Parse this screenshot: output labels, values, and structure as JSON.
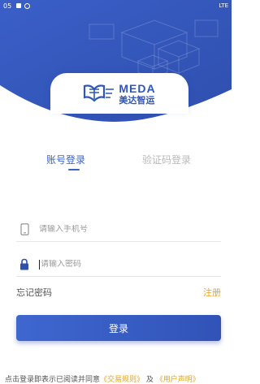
{
  "status_bar": {
    "time": "05",
    "right": "LTE"
  },
  "brand": {
    "logo_en": "MEDA",
    "logo_cn": "美达智运"
  },
  "tabs": {
    "account": "账号登录",
    "sms": "验证码登录"
  },
  "form": {
    "phone_placeholder": "请输入手机号",
    "password_placeholder": "请输入密码",
    "forgot": "忘记密码",
    "register": "注册",
    "login_button": "登录"
  },
  "agreement": {
    "prefix": "点击登录即表示已阅读并同意",
    "link1": "《交易规则》",
    "conj": "及",
    "link2": "《用户声明》"
  },
  "colors": {
    "primary": "#3a63c8",
    "header_blue": "#3556bd",
    "accent": "#e6a323"
  }
}
